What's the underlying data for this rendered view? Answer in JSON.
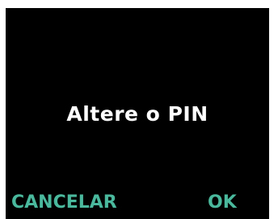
{
  "dialog": {
    "message": "Altere o PIN"
  },
  "softkeys": {
    "left_label": "CANCELAR",
    "right_label": "OK"
  },
  "colors": {
    "background": "#000000",
    "message_text": "#ffffff",
    "softkey_text": "#4ab89c"
  }
}
